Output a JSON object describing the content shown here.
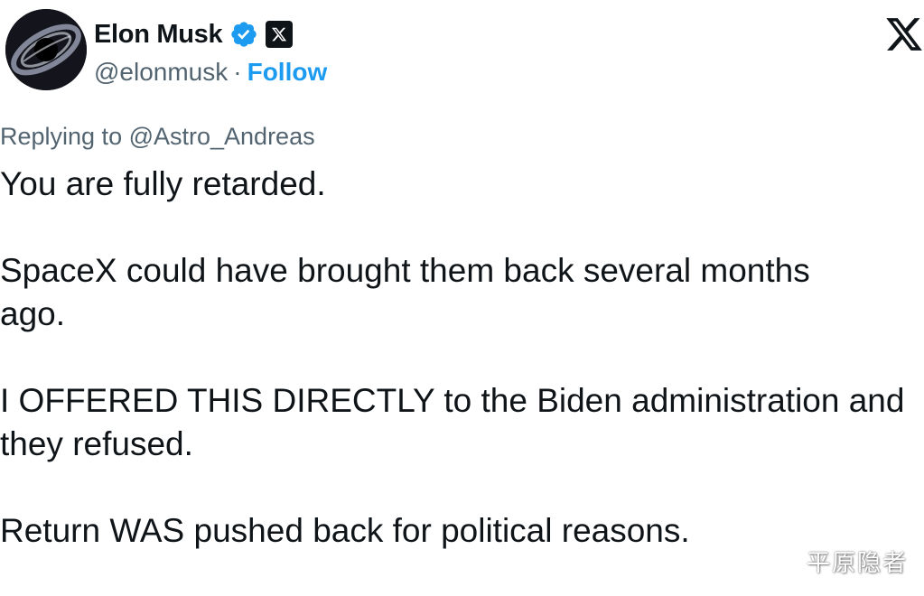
{
  "author": {
    "display_name": "Elon Musk",
    "handle": "@elonmusk",
    "separator": "·",
    "follow_label": "Follow"
  },
  "tweet": {
    "reply_to": "Replying to @Astro_Andreas",
    "paragraphs": [
      [
        "You are fully retarded."
      ],
      [
        "SpaceX could have brought them back several months",
        "ago."
      ],
      [
        "I OFFERED THIS DIRECTLY to the Biden administration and",
        "they refused."
      ],
      [
        "Return WAS pushed back for political reasons."
      ]
    ]
  },
  "watermark": "平原隐者",
  "colors": {
    "text": "#0f1419",
    "secondary": "#536471",
    "accent": "#1d9bf0"
  },
  "icons": [
    "avatar",
    "verified-icon",
    "x-badge-icon",
    "x-logo-icon"
  ]
}
